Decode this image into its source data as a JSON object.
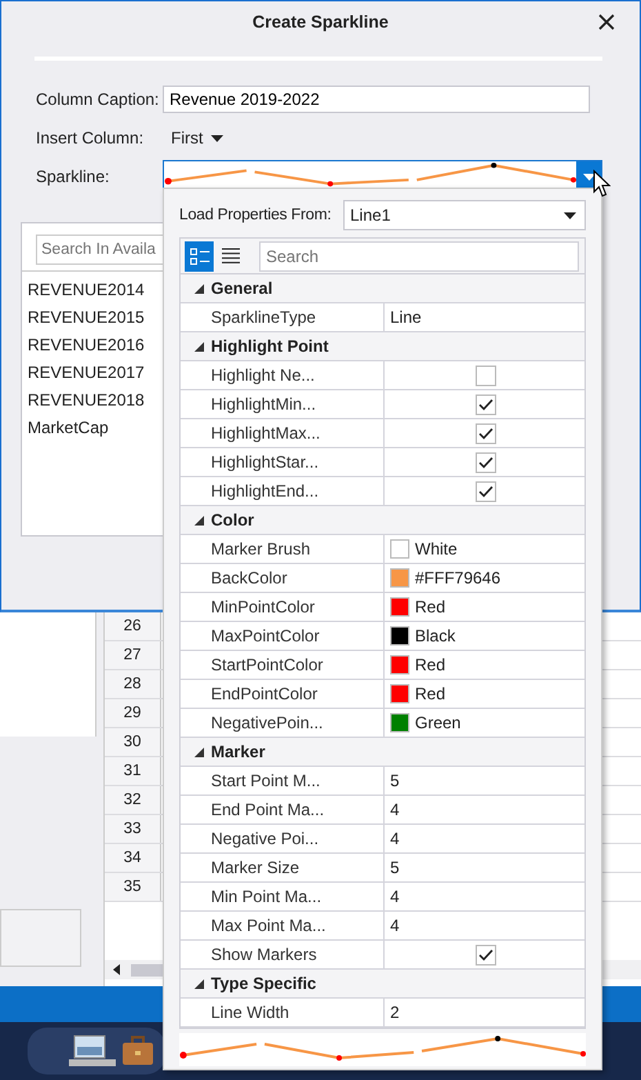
{
  "dialog": {
    "title": "Create Sparkline",
    "caption_label": "Column Caption:",
    "caption_value": "Revenue 2019-2022",
    "insert_label": "Insert Column:",
    "insert_value": "First",
    "sparkline_label": "Sparkline:",
    "search_placeholder": "Search In Availa",
    "columns": [
      "REVENUE2014",
      "REVENUE2015",
      "REVENUE2016",
      "REVENUE2017",
      "REVENUE2018",
      "MarketCap"
    ]
  },
  "grid": {
    "row_numbers": [
      "26",
      "27",
      "28",
      "29",
      "30",
      "31",
      "32",
      "33",
      "34",
      "35"
    ]
  },
  "popup": {
    "load_label": "Load Properties From:",
    "load_value": "Line1",
    "categorized_selected": true,
    "alphabetical_selected": false,
    "search_placeholder": "Search",
    "properties": [
      {
        "category": "General",
        "expanded": true,
        "items": [
          {
            "name": "SparklineType",
            "kind": "text",
            "value": "Line"
          }
        ]
      },
      {
        "category": "Highlight Point",
        "expanded": true,
        "items": [
          {
            "name": "Highlight Ne...",
            "kind": "check",
            "checked": false
          },
          {
            "name": "HighlightMin...",
            "kind": "check",
            "checked": true
          },
          {
            "name": "HighlightMax...",
            "kind": "check",
            "checked": true
          },
          {
            "name": "HighlightStar...",
            "kind": "check",
            "checked": true
          },
          {
            "name": "HighlightEnd...",
            "kind": "check",
            "checked": true
          }
        ]
      },
      {
        "category": "Color",
        "expanded": true,
        "items": [
          {
            "name": "Marker Brush",
            "kind": "color",
            "color": "#ffffff",
            "value": "White"
          },
          {
            "name": "BackColor",
            "kind": "color",
            "color": "#f79646",
            "value": "#FFF79646"
          },
          {
            "name": "MinPointColor",
            "kind": "color",
            "color": "#ff0000",
            "value": "Red"
          },
          {
            "name": "MaxPointColor",
            "kind": "color",
            "color": "#000000",
            "value": "Black"
          },
          {
            "name": "StartPointColor",
            "kind": "color",
            "color": "#ff0000",
            "value": "Red"
          },
          {
            "name": "EndPointColor",
            "kind": "color",
            "color": "#ff0000",
            "value": "Red"
          },
          {
            "name": "NegativePoin...",
            "kind": "color",
            "color": "#008000",
            "value": "Green"
          }
        ]
      },
      {
        "category": "Marker",
        "expanded": true,
        "items": [
          {
            "name": "Start Point M...",
            "kind": "text",
            "value": "5"
          },
          {
            "name": "End Point Ma...",
            "kind": "text",
            "value": "4"
          },
          {
            "name": "Negative Poi...",
            "kind": "text",
            "value": "4"
          },
          {
            "name": "Marker Size",
            "kind": "text",
            "value": "5"
          },
          {
            "name": "Min Point Ma...",
            "kind": "text",
            "value": "4"
          },
          {
            "name": "Max Point Ma...",
            "kind": "text",
            "value": "4"
          },
          {
            "name": "Show Markers",
            "kind": "check",
            "checked": true
          }
        ]
      },
      {
        "category": "Type Specific",
        "expanded": true,
        "items": [
          {
            "name": "Line Width",
            "kind": "text",
            "value": "2"
          }
        ]
      }
    ]
  }
}
